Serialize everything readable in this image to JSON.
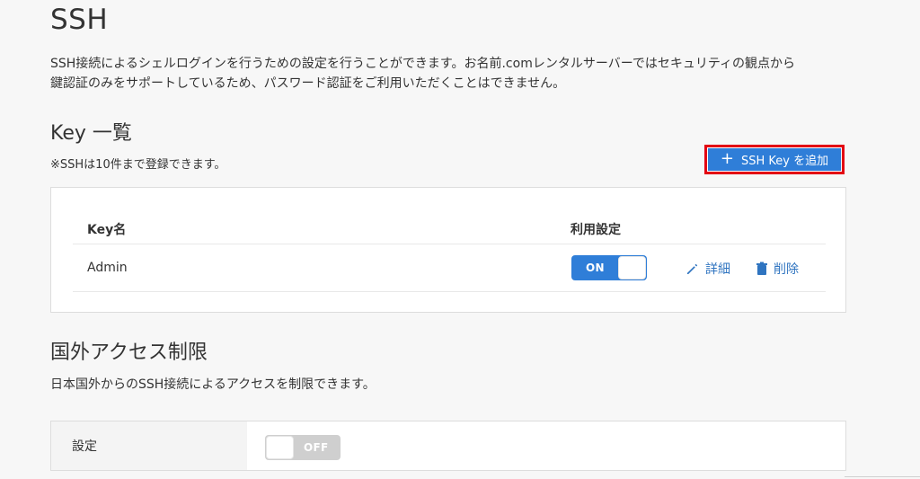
{
  "page": {
    "title": "SSH",
    "description_line1": "SSH接続によるシェルログインを行うための設定を行うことができます。お名前.comレンタルサーバーではセキュリティの観点から",
    "description_line2": "鍵認証のみをサポートしているため、パスワード認証をご利用いただくことはできません。"
  },
  "key_section": {
    "title": "Key 一覧",
    "note": "※SSHは10件まで登録できます。",
    "add_button_label": "SSH Key を追加",
    "add_button_icon": "plus-icon",
    "table": {
      "columns": [
        "Key名",
        "利用設定"
      ],
      "rows": [
        {
          "key_name": "Admin",
          "status": "ON",
          "detail_label": "詳細",
          "delete_label": "削除",
          "detail_icon": "pencil-icon",
          "delete_icon": "trash-icon"
        }
      ]
    }
  },
  "foreign_access": {
    "title": "国外アクセス制限",
    "description": "日本国外からのSSH接続によるアクセスを制限できます。",
    "setting_label": "設定",
    "toggle_state": "OFF"
  },
  "colors": {
    "accent": "#2f7ed8",
    "link": "#2f74c0",
    "highlight_border": "#e30613",
    "toggle_off": "#cfcfcf"
  }
}
